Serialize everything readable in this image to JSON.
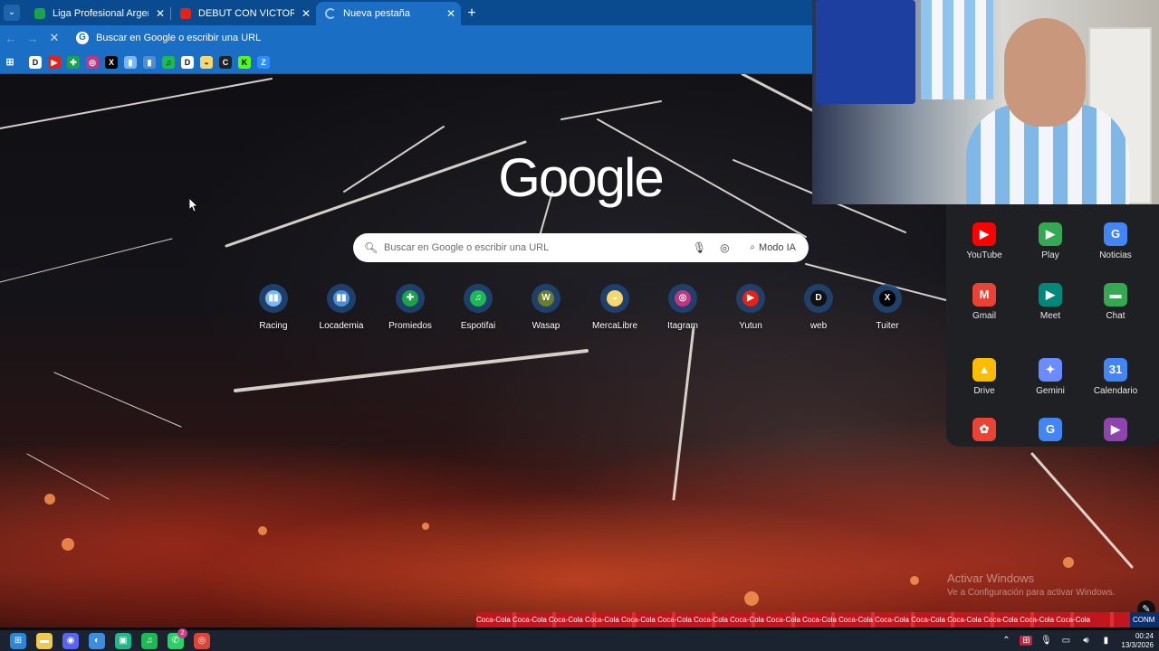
{
  "browser": {
    "tabs": [
      {
        "title": "Liga Profesional Argentina - PC",
        "favicon_color": "#1aa34a",
        "active": false
      },
      {
        "title": "DEBUT CON VICTORIA PARA EL",
        "favicon_color": "#e62117",
        "active": false
      },
      {
        "title": "Nueva pestaña",
        "favicon_color": "#9cc8ff",
        "active": true
      }
    ],
    "new_tab_symbol": "+",
    "close_symbol": "✕",
    "omnibox_placeholder": "Buscar en Google o escribir una URL",
    "bookmarks": [
      {
        "icon": "D",
        "color": "#ffffff",
        "fg": "#111"
      },
      {
        "icon": "▶",
        "color": "#e62117",
        "fg": "#fff"
      },
      {
        "icon": "✚",
        "color": "#1aa34a",
        "fg": "#fff"
      },
      {
        "icon": "◎",
        "color": "#c13584",
        "fg": "#fff"
      },
      {
        "icon": "X",
        "color": "#000000",
        "fg": "#fff"
      },
      {
        "icon": "▮",
        "color": "#7ab8f5",
        "fg": "#fff"
      },
      {
        "icon": "▮",
        "color": "#4d8fd6",
        "fg": "#fff"
      },
      {
        "icon": "♫",
        "color": "#1db954",
        "fg": "#000"
      },
      {
        "icon": "D",
        "color": "#ffffff",
        "fg": "#111"
      },
      {
        "icon": "◒",
        "color": "#f5d76e",
        "fg": "#333"
      },
      {
        "icon": "C",
        "color": "#222222",
        "fg": "#fff"
      },
      {
        "icon": "K",
        "color": "#53fc18",
        "fg": "#000"
      },
      {
        "icon": "Z",
        "color": "#2d8cff",
        "fg": "#fff"
      }
    ]
  },
  "newtab": {
    "logo": "Google",
    "search_placeholder": "Buscar en Google o escribir una URL",
    "modo_ia_label": "Modo IA",
    "shortcuts": [
      {
        "label": "Racing",
        "icon": "▮▮",
        "color": "#7ab8f5"
      },
      {
        "label": "Locademia",
        "icon": "▮▮",
        "color": "#4d8fd6"
      },
      {
        "label": "Promiedos",
        "icon": "✚",
        "color": "#1aa34a"
      },
      {
        "label": "Espotifai",
        "icon": "♫",
        "color": "#1db954"
      },
      {
        "label": "Wasap",
        "icon": "W",
        "color": "#6b7d2e"
      },
      {
        "label": "MercaLibre",
        "icon": "◒",
        "color": "#f5d76e"
      },
      {
        "label": "Itagram",
        "icon": "◎",
        "color": "#c13584"
      },
      {
        "label": "Yutun",
        "icon": "▶",
        "color": "#e62117"
      },
      {
        "label": "web",
        "icon": "D",
        "color": "#111111"
      },
      {
        "label": "Tuiter",
        "icon": "X",
        "color": "#000000"
      }
    ]
  },
  "apps_panel": {
    "apps": [
      {
        "label": "YouTube",
        "icon": "▶",
        "color": "#ff0000"
      },
      {
        "label": "Play",
        "icon": "▶",
        "color": "#34a853"
      },
      {
        "label": "Noticias",
        "icon": "G",
        "color": "#4285f4"
      },
      {
        "label": "Gmail",
        "icon": "M",
        "color": "#ea4335"
      },
      {
        "label": "Meet",
        "icon": "▶",
        "color": "#00897b"
      },
      {
        "label": "Chat",
        "icon": "▬",
        "color": "#34a853"
      },
      {
        "label": "Drive",
        "icon": "▲",
        "color": "#fbbc04"
      },
      {
        "label": "Gemini",
        "icon": "✦",
        "color": "#6b8cff"
      },
      {
        "label": "Calendario",
        "icon": "31",
        "color": "#4285f4"
      },
      {
        "label": "",
        "icon": "✿",
        "color": "#ea4335"
      },
      {
        "label": "",
        "icon": "G",
        "color": "#4285f4"
      },
      {
        "label": "",
        "icon": "▶",
        "color": "#8e44ad"
      }
    ]
  },
  "watermark": {
    "line1": "Activar Windows",
    "line2": "Ve a Configuración para activar Windows."
  },
  "adboard": {
    "text": "Coca-Cola  Coca-Cola  Coca-Cola  Coca-Cola  Coca-Cola  Coca-Cola  Coca-Cola  Coca-Cola  Coca-Cola  Coca-Cola  Coca-Cola  Coca-Cola  Coca-Cola  Coca-Cola  Coca-Cola  Coca-Cola  Coca-Cola",
    "badge": "CONM"
  },
  "taskbar": {
    "apps": [
      {
        "name": "start",
        "icon": "⊞",
        "color": "#2b88d8"
      },
      {
        "name": "file-explorer",
        "icon": "▬",
        "color": "#f2c94c"
      },
      {
        "name": "discord",
        "icon": "◉",
        "color": "#5865f2"
      },
      {
        "name": "app-blue",
        "icon": "◐",
        "color": "#3c8de0"
      },
      {
        "name": "app-green",
        "icon": "▣",
        "color": "#1fb88a"
      },
      {
        "name": "spotify",
        "icon": "♫",
        "color": "#1db954"
      },
      {
        "name": "whatsapp",
        "icon": "✆",
        "color": "#25d366",
        "badge": "2"
      },
      {
        "name": "chrome",
        "icon": "◎",
        "color": "#db4437"
      }
    ],
    "time": "00:24",
    "date": "13/3/2026"
  }
}
